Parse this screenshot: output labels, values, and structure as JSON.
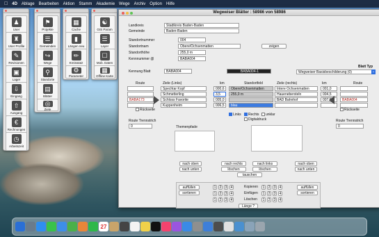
{
  "menubar": {
    "apple": "",
    "app": "4D",
    "items": [
      "Ablage",
      "Bearbeiten",
      "Aktion",
      "Stamm",
      "Akademie",
      "Wege",
      "Archiv",
      "Option",
      "Hilfe"
    ]
  },
  "palettes": {
    "p1": [
      {
        "label": "User",
        "icon": "user-icon"
      },
      {
        "label": "User Profile",
        "icon": "user-profile-icon"
      },
      {
        "label": "Revisionen",
        "icon": "revisions-icon"
      },
      {
        "label": "Lager",
        "icon": "storage-icon"
      },
      {
        "label": "Eingang",
        "icon": "inbox-icon"
      },
      {
        "label": "Ausgang",
        "icon": "outbox-icon"
      },
      {
        "label": "Rechnungen",
        "icon": "invoice-icon"
      },
      {
        "label": "Arbeitszeit",
        "icon": "clock-icon"
      }
    ],
    "p2": [
      {
        "label": "Projekte",
        "icon": "tag-icon"
      },
      {
        "label": "Gemeinden",
        "icon": "layers-icon"
      },
      {
        "label": "Wege",
        "icon": "route-icon"
      },
      {
        "label": "Standorte",
        "icon": "location-icon"
      },
      {
        "label": "Blätter",
        "icon": "sheets-icon"
      },
      {
        "label": "Ziele",
        "icon": "target-icon"
      }
    ],
    "p3": [
      {
        "label": "Cache",
        "icon": "cache-icon"
      },
      {
        "label": "Längen neu",
        "icon": "ruler-icon"
      },
      {
        "label": "Kreisstatz",
        "icon": "pencil-icon"
      },
      {
        "label": "Parameter",
        "icon": "parameter-icon"
      }
    ],
    "p4": [
      {
        "label": "GIS Param",
        "icon": "globe-icon"
      },
      {
        "label": "Layer",
        "icon": "layer-icon"
      },
      {
        "label": "Mob. Daten",
        "icon": "mobile-icon"
      },
      {
        "label": "Offline Karte",
        "icon": "map-icon"
      }
    ]
  },
  "window": {
    "title": "Wegweiser Blätter : 58986 von 58986",
    "labels": {
      "landkreis": "Landkreis",
      "gemeinde": "Gemeinde",
      "standortnummer": "Standortnummer",
      "standortname": "Standortnam",
      "standorthoehe": "Standorthöhe",
      "kennnummer": "Kennnummer @",
      "kennung": "Kennung Blatt",
      "blatt_typ": "Blatt Typ",
      "route_l": "Route",
      "ziele_links": "Ziele (Links)",
      "km_l": "km",
      "standortfeld": "Standortfeld",
      "ziele_rechts": "Ziele (rechts)",
      "km_r": "km",
      "route_r": "Route",
      "rueckseite_l": "Rückseite",
      "rueckseite_r": "Rückseite",
      "links": "Links",
      "rechts": "Rechts",
      "unklar": "unklar",
      "digitaldruck": "Digitaldruck",
      "route_trenn_l": "Route Trennstrich",
      "route_trenn_r": "Route Trennstrich",
      "themenpfade": "Themenpfade",
      "kopieren": "Kopieren",
      "einfuegen": "Einfügen",
      "loeschen_lbl": "Löschen"
    },
    "values": {
      "landkreis": "Stadtkreis Baden-Baden",
      "gemeinde": "Baden-Baden",
      "standortnummer": "004",
      "standortname": "Obere/Ochsenmatten",
      "standorthoehe": "255,0 m",
      "kennnummer": "BABA004",
      "kennung": "BABA004",
      "kennung_dark": "BABA004-1",
      "blatt_typ": "Wegweiser Basisbeschilderung (0)",
      "route_left": "BABA173",
      "route_right": "BABA004",
      "trenn_l": "0",
      "trenn_r": "0",
      "standort_feld": "255,0 m",
      "blau": "blau"
    },
    "left_rows": [
      {
        "ziel": "Spechtar Kopf",
        "km": "000,6"
      },
      {
        "ziel": "Schmetterling",
        "km": "3,5"
      },
      {
        "ziel": "Schloss Favorite",
        "km": "005,0"
      },
      {
        "ziel": "Kuppenheim",
        "km": "006,5"
      }
    ],
    "mid_rows": [
      "Obere/Ochsenmatten",
      "255,0 m",
      "",
      ""
    ],
    "right_rows": [
      {
        "ziel": "Intere Ochsenmatten",
        "km": "001,0"
      },
      {
        "ziel": "Hauenebersteln",
        "km": "004,5"
      },
      {
        "ziel": "BAD Bahnhof",
        "km": "007,5"
      },
      {
        "ziel": "",
        "km": ""
      }
    ],
    "buttons": {
      "zeigen": "zeigen",
      "nach_oben": "nach oben",
      "nach_unten": "nach unten",
      "nach_rechts": "nach rechts",
      "nach_links": "nach links",
      "loeschen": "löschen",
      "tauschen": "tauschen",
      "auffuellen": "auffüllen",
      "sortieren": "sortieren",
      "laenge": "Länge ?"
    },
    "numbers": [
      "1",
      "2",
      "3",
      "4"
    ]
  },
  "dock": {
    "calendar_day": "27"
  }
}
